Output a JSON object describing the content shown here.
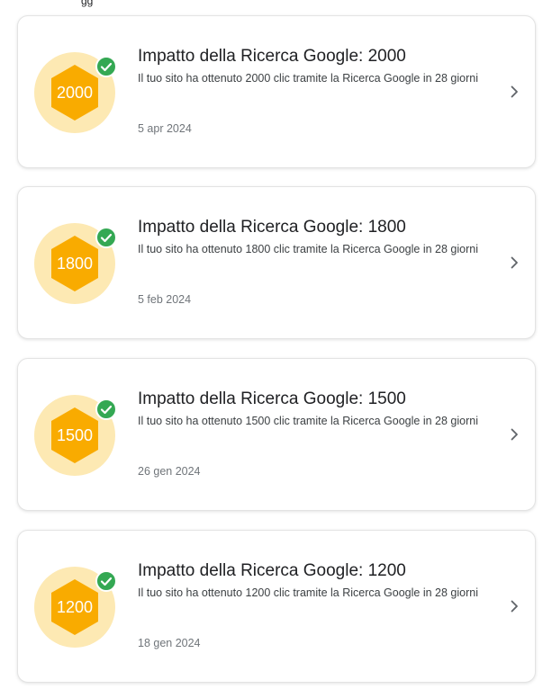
{
  "colors": {
    "badge_bg": "#fde9b3",
    "badge_hex": "#f9ab00",
    "check": "#34a853",
    "chevron": "#5f6368"
  },
  "top_clipped_text": "gg",
  "achievements": [
    {
      "badge_number": "2000",
      "title": "Impatto della Ricerca Google: 2000",
      "description": "Il tuo sito ha ottenuto 2000 clic tramite la Ricerca Google in 28 giorni",
      "date": "5 apr 2024",
      "icons": {
        "check": "check-circle-icon",
        "chevron": "chevron-right-icon"
      }
    },
    {
      "badge_number": "1800",
      "title": "Impatto della Ricerca Google: 1800",
      "description": "Il tuo sito ha ottenuto 1800 clic tramite la Ricerca Google in 28 giorni",
      "date": "5 feb 2024",
      "icons": {
        "check": "check-circle-icon",
        "chevron": "chevron-right-icon"
      }
    },
    {
      "badge_number": "1500",
      "title": "Impatto della Ricerca Google: 1500",
      "description": "Il tuo sito ha ottenuto 1500 clic tramite la Ricerca Google in 28 giorni",
      "date": "26 gen 2024",
      "icons": {
        "check": "check-circle-icon",
        "chevron": "chevron-right-icon"
      }
    },
    {
      "badge_number": "1200",
      "title": "Impatto della Ricerca Google: 1200",
      "description": "Il tuo sito ha ottenuto 1200 clic tramite la Ricerca Google in 28 giorni",
      "date": "18 gen 2024",
      "icons": {
        "check": "check-circle-icon",
        "chevron": "chevron-right-icon"
      }
    }
  ]
}
